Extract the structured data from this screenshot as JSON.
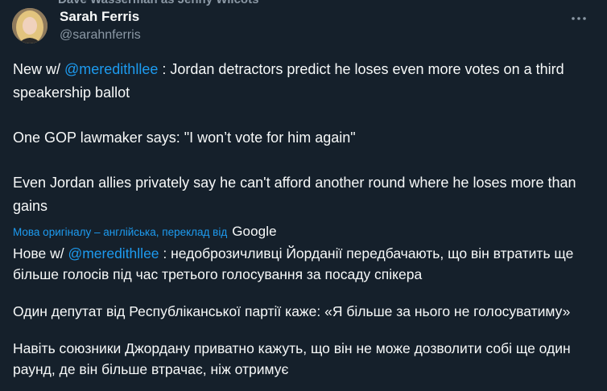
{
  "top_cut_text": "Dave Wasserman as Jenny Wilcots",
  "author": {
    "name": "Sarah Ferris",
    "handle": "@sarahnferris"
  },
  "menu_icon": "more-horizontal-icon",
  "tweet": {
    "para1": {
      "prefix": "New w/ ",
      "mention": "@meredithllee",
      "rest": " : Jordan detractors predict he loses even more votes on a third speakership ballot"
    },
    "para2": "One GOP lawmaker says: \"I won’t vote for him again\"",
    "para3": "Even Jordan allies privately say he can't afford another round where he loses more than gains"
  },
  "translation_note": {
    "text": "Мова оригіналу – англійська, переклад від",
    "provider": "Google"
  },
  "translation": {
    "para1": {
      "prefix": "Нове w/ ",
      "mention": "@meredithllee",
      "rest": " : недоброзичливці Йорданії передбачають, що він втратить ще більше голосів під час третього голосування за посаду спікера"
    },
    "para2": "Один депутат від Республіканської партії каже: «Я більше за нього не голосуватиму»",
    "para3": "Навіть союзники Джордану приватно кажуть, що він не може дозволити собі ще один раунд, де він більше втрачає, ніж отримує"
  },
  "colors": {
    "background": "#15202b",
    "text": "#f7f9f9",
    "secondary": "#8b98a5",
    "accent": "#1d9bf0"
  }
}
